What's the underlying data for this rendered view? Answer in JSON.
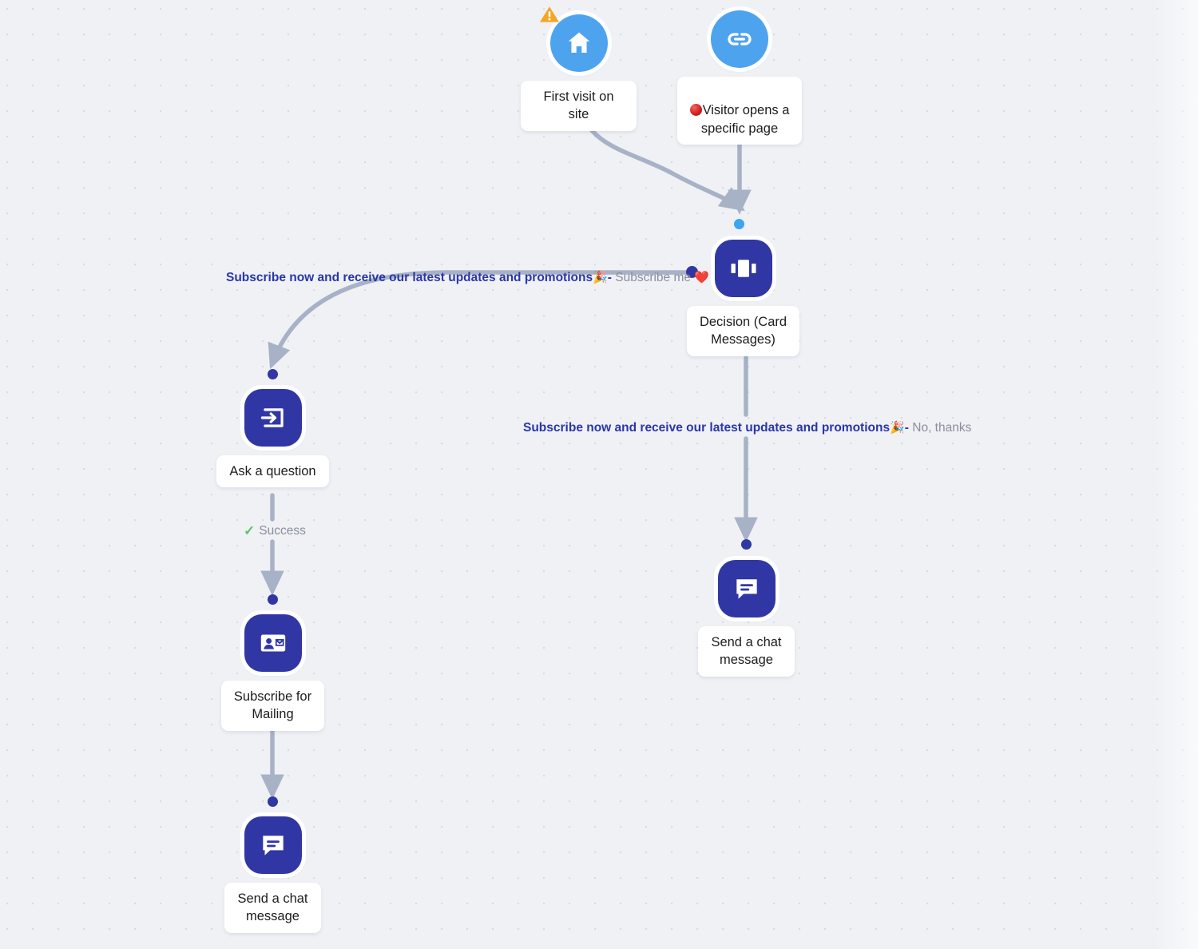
{
  "canvas": {
    "background_color": "#eff1f5",
    "dot_grid_color": "#a0a8bc"
  },
  "palette": {
    "trigger_blue": "#4ea3ee",
    "action_navy": "#3037a5",
    "edge_grey": "#a8b2c6",
    "label_blue": "#2b36a8",
    "label_grey": "#8a8f9c",
    "success_green": "#63c264",
    "warning_orange": "#f5a623"
  },
  "nodes": [
    {
      "id": "first-visit",
      "label": "First visit on site",
      "icon": "home-icon",
      "icon_style": "circle-blue",
      "badge": "warning-triangle-icon"
    },
    {
      "id": "visitor-opens-page",
      "label": "Visitor opens a\nspecific page",
      "label_prefix_emoji": "🔴",
      "icon": "link-icon",
      "icon_style": "circle-blue",
      "badge": null
    },
    {
      "id": "decision-card-messages",
      "label": "Decision (Card\nMessages)",
      "icon": "carousel-cards-icon",
      "icon_style": "rounded-navy",
      "badge": null
    },
    {
      "id": "ask-a-question",
      "label": "Ask a question",
      "icon": "input-arrow-icon",
      "icon_style": "rounded-navy",
      "badge": null
    },
    {
      "id": "subscribe-for-mailing",
      "label": "Subscribe for\nMailing",
      "icon": "contact-mail-card-icon",
      "icon_style": "rounded-navy",
      "badge": null
    },
    {
      "id": "send-chat-message-left",
      "label": "Send a chat\nmessage",
      "icon": "chat-bubble-icon",
      "icon_style": "rounded-navy",
      "badge": null
    },
    {
      "id": "send-chat-message-right",
      "label": "Send a chat\nmessage",
      "icon": "chat-bubble-icon",
      "icon_style": "rounded-navy",
      "badge": null
    }
  ],
  "edge_labels": {
    "subscribe_me": {
      "condition": "Subscribe now and receive our latest updates and promotions",
      "condition_emoji": "🎉",
      "separator": "-",
      "answer": "Subscribe me",
      "answer_emoji": "❤️"
    },
    "no_thanks": {
      "condition": "Subscribe now and receive our latest updates and promotions",
      "condition_emoji": "🎉",
      "separator": "-",
      "answer": "No, thanks",
      "answer_emoji": ""
    },
    "success": {
      "icon": "check-icon",
      "text": "Success"
    }
  }
}
